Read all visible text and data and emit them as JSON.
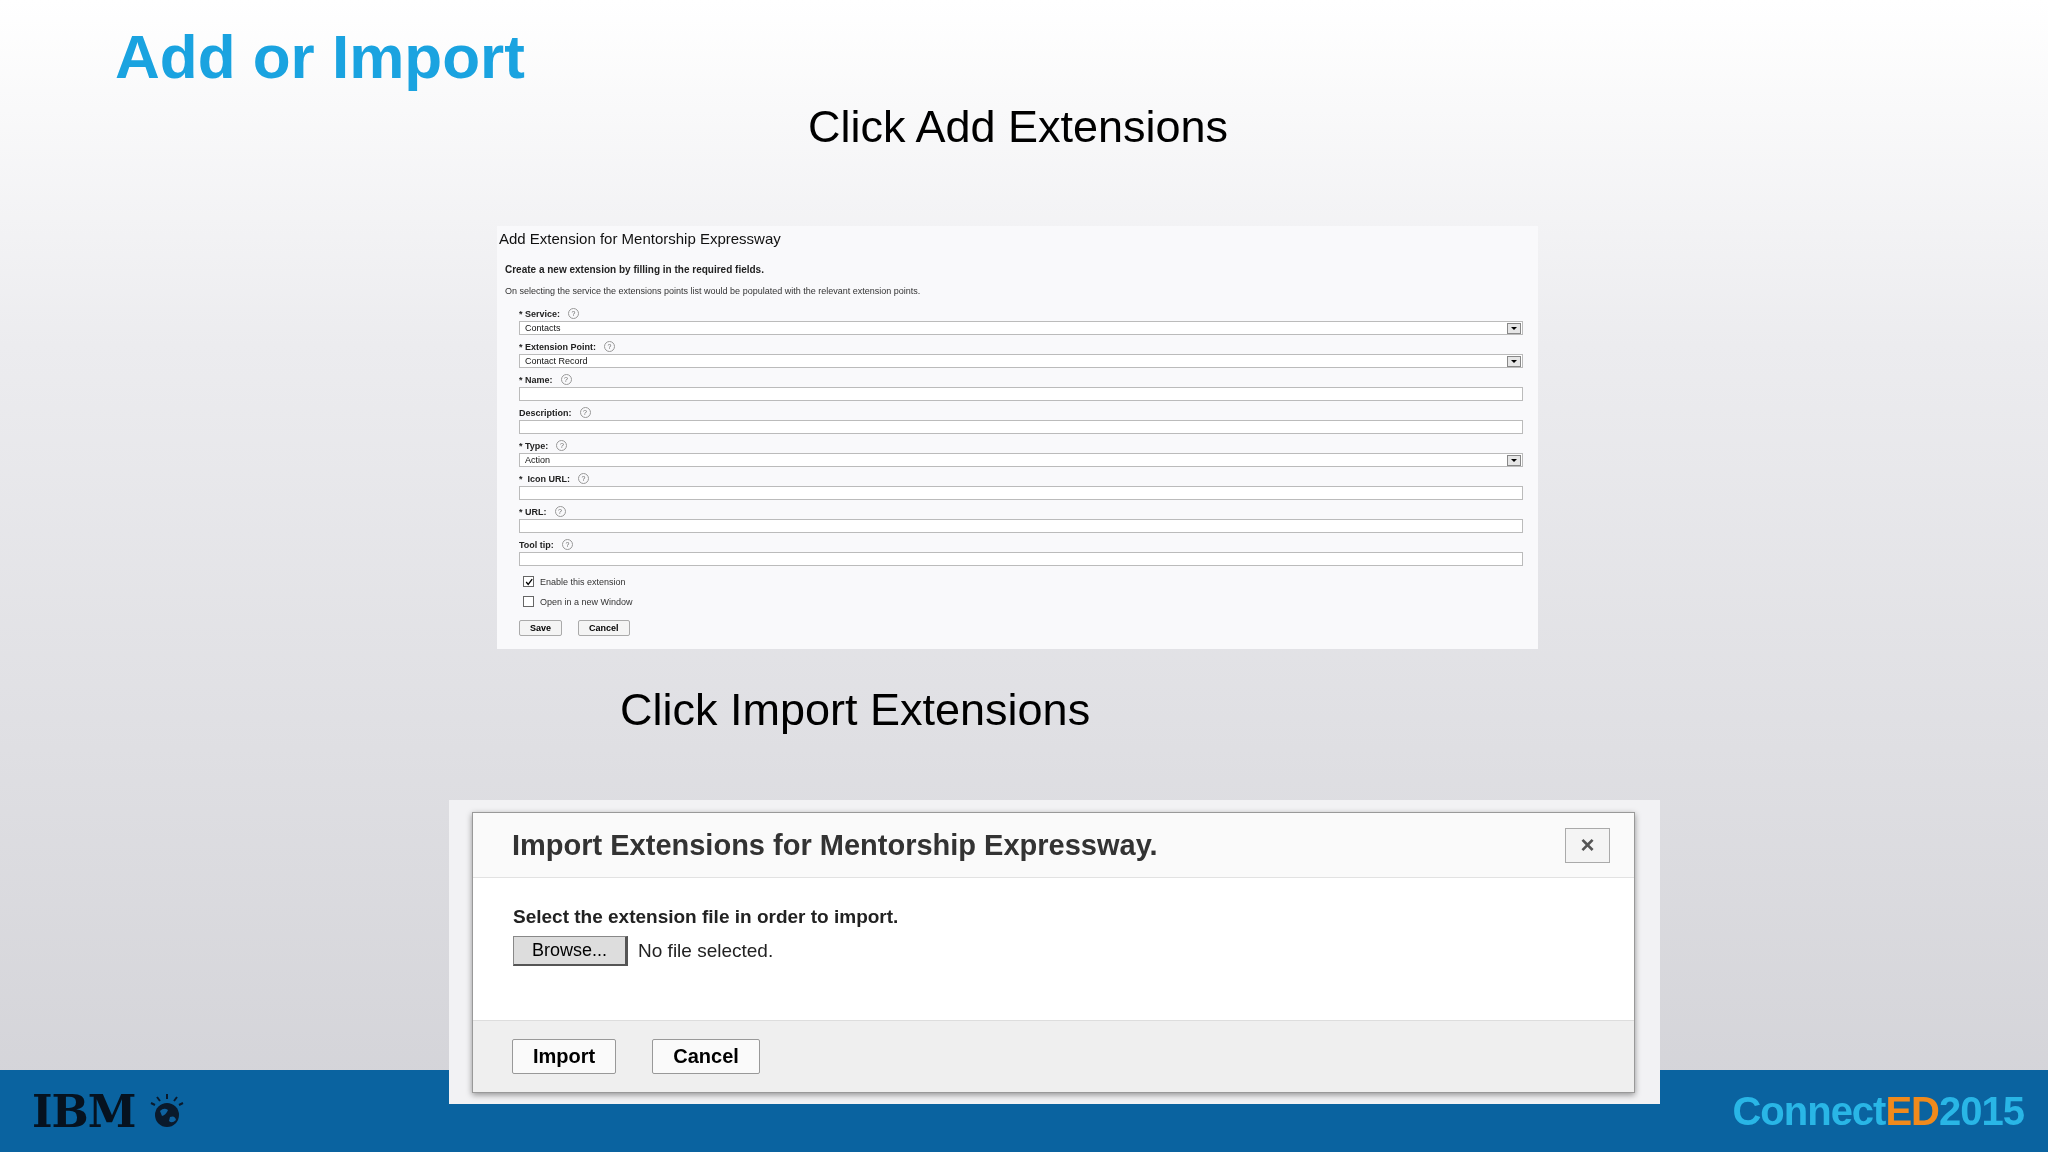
{
  "slide": {
    "title": "Add or Import",
    "step_1": "Click Add Extensions",
    "step_2": "Click Import Extensions"
  },
  "add_form": {
    "title": "Add Extension for Mentorship Expressway",
    "intro": "Create a new extension by filling in the required fields.",
    "note": "On selecting the service the extensions points list would be populated with the relevant extension points.",
    "fields": [
      {
        "kind": "select",
        "label": "* Service:",
        "help": "?",
        "value": "Contacts"
      },
      {
        "kind": "select",
        "label": "* Extension Point:",
        "help": "?",
        "value": "Contact Record"
      },
      {
        "kind": "text",
        "label": "* Name:",
        "help": "?"
      },
      {
        "kind": "text",
        "label": "Description:",
        "help": "?"
      },
      {
        "kind": "select",
        "label": "* Type:",
        "help": "?",
        "value": "Action"
      },
      {
        "kind": "text",
        "label": "*  Icon URL:",
        "help": "?"
      },
      {
        "kind": "text",
        "label": "* URL:",
        "help": "?"
      },
      {
        "kind": "text",
        "label": "Tool tip:",
        "help": "?"
      }
    ],
    "options": [
      {
        "label": "Enable this extension",
        "checked": true
      },
      {
        "label": "Open in a new Window",
        "checked": false
      }
    ],
    "buttons": [
      "Save",
      "Cancel"
    ]
  },
  "import_dialog": {
    "title": "Import Extensions for Mentorship Expressway.",
    "close": "×",
    "prompt": "Select the extension file in order to import.",
    "browse": "Browse...",
    "file_status": "No file selected.",
    "buttons": [
      "Import",
      "Cancel"
    ]
  },
  "footer": {
    "logo": "IBM",
    "brand": [
      {
        "text": "Connect",
        "color": "#29b6e6"
      },
      {
        "text": "ED",
        "color": "#f08a1c"
      },
      {
        "text": "2015",
        "color": "#29b6e6"
      }
    ]
  }
}
